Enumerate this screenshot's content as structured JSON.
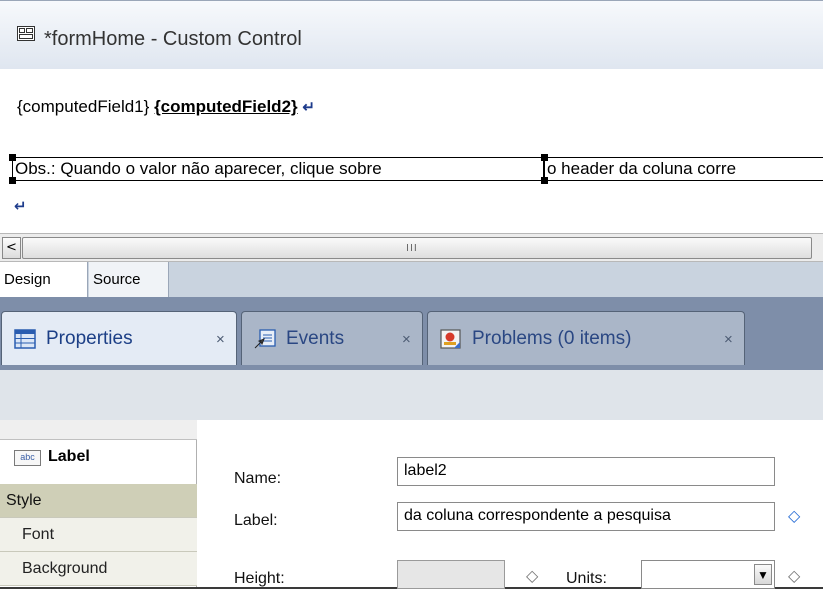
{
  "editor": {
    "title": "*formHome - Custom Control",
    "computed_field_1": "{computedField1}",
    "computed_field_2": "{computedField2}",
    "pilcrow": "↵",
    "obs_part_1": "Obs.: Quando o valor não aparecer, clique sobre",
    "obs_part_2": "o header da coluna corre",
    "scroll_grip": "III",
    "scroll_left_arrow": "<",
    "mode_tabs": {
      "design": "Design",
      "source": "Source",
      "active": "Design"
    }
  },
  "views": {
    "tabs": [
      {
        "label": "Properties",
        "icon": "properties-table-icon",
        "active": true
      },
      {
        "label": "Events",
        "icon": "events-icon",
        "active": false
      },
      {
        "label": "Problems (0 items)",
        "icon": "problems-icon",
        "active": false
      }
    ],
    "close_glyph": "×"
  },
  "properties": {
    "control_type": "Label",
    "abc_icon_text": "abc",
    "sidebar": [
      "Style",
      "Font",
      "Background"
    ],
    "selected_section": "Style",
    "fields": {
      "name": {
        "label": "Name:",
        "value": "label2"
      },
      "label": {
        "label": "Label:",
        "value": "da coluna correspondente a pesquisa"
      },
      "height": {
        "label": "Height:",
        "value": ""
      },
      "units": {
        "label": "Units:",
        "value": ""
      }
    },
    "diamond_glyph": "◇"
  },
  "colors": {
    "view_bar": "#7e8ea9",
    "active_tab_text": "#1c3f86",
    "style_row": "#cfcfb7",
    "diamond": "#2b6fd6"
  }
}
